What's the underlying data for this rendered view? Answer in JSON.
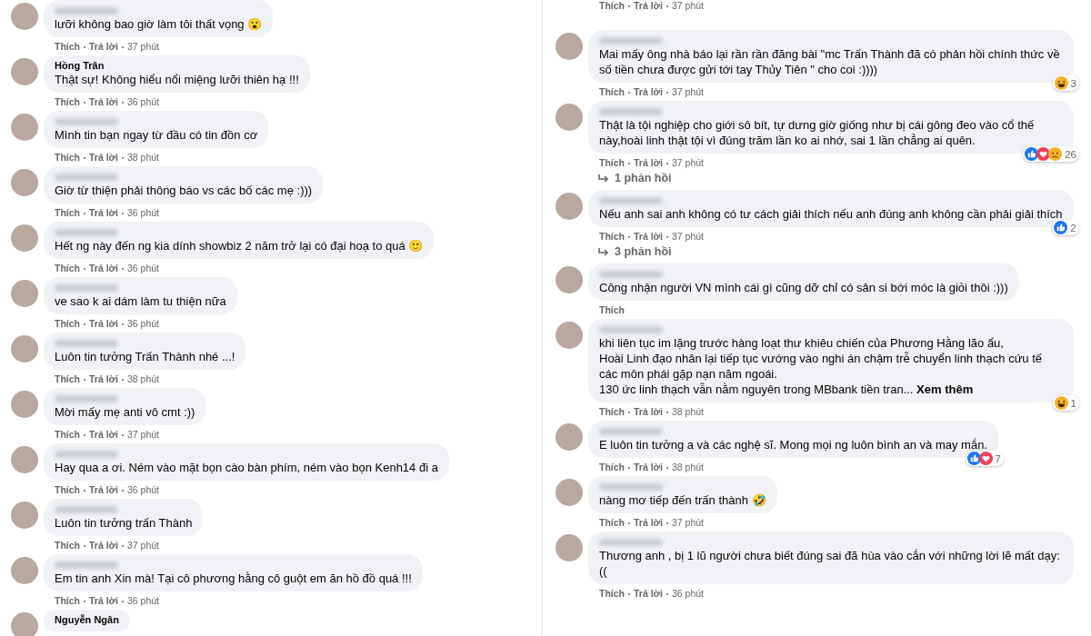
{
  "columns": [
    {
      "comments": [
        {
          "text": "lưỡi không bao giờ làm tôi thất vọng 😮",
          "actions": {
            "like": "Thích",
            "reply": "Trả lời",
            "time": "37 phút"
          }
        },
        {
          "name": "Hồng Trân",
          "text": "Thật sự! Không hiểu nổi miệng lưỡi thiên hạ !!!",
          "actions": {
            "like": "Thích",
            "reply": "Trả lời",
            "time": "36 phút"
          }
        },
        {
          "text": "Mình tin bạn ngay từ đầu có tin đồn cơ",
          "actions": {
            "like": "Thích",
            "reply": "Trả lời",
            "time": "38 phút"
          }
        },
        {
          "text": "Giờ từ thiện phải thông báo vs các bố các mẹ :)))",
          "actions": {
            "like": "Thích",
            "reply": "Trả lời",
            "time": "36 phút"
          }
        },
        {
          "text": "Hết ng này đến ng kia dính showbiz 2 năm trở lại có đại hoạ to quá 🙂",
          "actions": {
            "like": "Thích",
            "reply": "Trả lời",
            "time": "36 phút"
          }
        },
        {
          "text": "ve sao k ai dám làm tu thiện nữa",
          "actions": {
            "like": "Thích",
            "reply": "Trả lời",
            "time": "36 phút"
          }
        },
        {
          "text": "Luôn tin tưởng Trấn Thành nhé ...!",
          "actions": {
            "like": "Thích",
            "reply": "Trả lời",
            "time": "38 phút"
          }
        },
        {
          "text": "Mời mấy mẹ anti vô cmt :))",
          "actions": {
            "like": "Thích",
            "reply": "Trả lời",
            "time": "37 phút"
          }
        },
        {
          "text": "Hay qua a ơi. Ném vào mặt bọn cào bàn phím, ném vào bọn Kenh14 đi a",
          "actions": {
            "like": "Thích",
            "reply": "Trả lời",
            "time": "36 phút"
          }
        },
        {
          "text": "Luôn tin tưởng trấn Thành",
          "actions": {
            "like": "Thích",
            "reply": "Trả lời",
            "time": "37 phút"
          }
        },
        {
          "text": "Em tin anh Xin mà! Tại cô phương hằng cô guột em ăn hồ đồ quá !!!",
          "actions": {
            "like": "Thích",
            "reply": "Trả lời",
            "time": "36 phút"
          }
        },
        {
          "name": "Nguyễn Ngân"
        }
      ]
    },
    {
      "comments": [
        {
          "actions": {
            "like": "Thích",
            "reply": "Trả lời",
            "time": "37 phút"
          }
        },
        {
          "text": "Mai mấy ông nhà báo lại rần rần đăng bài \"mc Trấn Thành đã có phản hồi chính thức về số tiền chưa được gửi tới tay Thủy Tiên \" cho coi :))))",
          "reactions": {
            "icons": [
              {
                "kind": "haha"
              }
            ],
            "count": "3"
          },
          "actions": {
            "like": "Thích",
            "reply": "Trả lời",
            "time": "37 phút"
          }
        },
        {
          "text": "Thật là tội nghiệp cho giới sô bít, tự dưng giờ giống như bị cái gông đeo vào cổ thế này,hoài linh thật tội vì đúng trăm lần ko ai nhớ, sai 1 lần chẳng ai quên.",
          "reactions": {
            "icons": [
              {
                "kind": "like"
              },
              {
                "kind": "love"
              },
              {
                "kind": "sad"
              }
            ],
            "count": "26"
          },
          "actions": {
            "like": "Thích",
            "reply": "Trả lời",
            "time": "37 phút"
          },
          "replies": "1 phản hồi"
        },
        {
          "text": "Nếu anh sai anh không có tư cách giải thích nếu anh đúng anh không cần phải giải thích",
          "reactions": {
            "icons": [
              {
                "kind": "like"
              }
            ],
            "count": "2"
          },
          "actions": {
            "like": "Thích",
            "reply": "Trả lời",
            "time": "37 phút"
          },
          "replies": "3 phản hồi"
        },
        {
          "text": "Công nhận người VN mình cái gì cũng dỡ chỉ có sân si bới móc là giỏi thôi :)))",
          "actions": {
            "like": "Thích"
          }
        },
        {
          "text": "khi liên tục im lặng trước hàng loạt thư khiêu chiến của Phương Hằng lão ẩu,\nHoài Linh đạo nhân lại tiếp tục vướng vào nghi án chậm trễ chuyển linh thạch cứu tế các môn phái gặp nạn năm ngoái.\n130 ức linh thạch vẫn nằm nguyên trong MBbank tiền tran...",
          "see_more": "Xem thêm",
          "reactions": {
            "icons": [
              {
                "kind": "haha"
              }
            ],
            "count": "1"
          },
          "actions": {
            "like": "Thích",
            "reply": "Trả lời",
            "time": "38 phút"
          }
        },
        {
          "text": "E luôn tin tưởng a và các nghệ sĩ. Mong mọi ng luôn bình an và may mắn.",
          "reactions": {
            "icons": [
              {
                "kind": "like"
              },
              {
                "kind": "love"
              }
            ],
            "count": "7"
          },
          "actions": {
            "like": "Thích",
            "reply": "Trả lời",
            "time": "38 phút"
          }
        },
        {
          "text": "nàng mơ tiếp đến trấn thành 🤣",
          "actions": {
            "like": "Thích",
            "reply": "Trả lời",
            "time": "37 phút"
          }
        },
        {
          "text": "Thương anh , bị 1 lũ người chưa biết đúng sai đã hùa vào cắn với những lời lẽ mất dạy:((",
          "actions": {
            "like": "Thích",
            "reply": "Trả lời",
            "time": "36 phút"
          }
        }
      ]
    }
  ]
}
